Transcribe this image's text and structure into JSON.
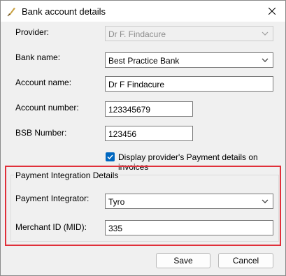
{
  "window": {
    "title": "Bank account details"
  },
  "form": {
    "provider": {
      "label": "Provider:",
      "value": "Dr F. Findacure"
    },
    "bank_name": {
      "label": "Bank name:",
      "value": "Best Practice Bank"
    },
    "account_name": {
      "label": "Account name:",
      "value": "Dr F Findacure"
    },
    "account_number": {
      "label": "Account number:",
      "value": "123345679"
    },
    "bsb_number": {
      "label": "BSB Number:",
      "value": "123456"
    },
    "display_checkbox": {
      "label": "Display provider's Payment details on invoices",
      "checked": true
    }
  },
  "payment_group": {
    "title": "Payment Integration Details",
    "integrator": {
      "label": "Payment Integrator:",
      "value": "Tyro"
    },
    "merchant_id": {
      "label": "Merchant ID (MID):",
      "value": "335"
    }
  },
  "buttons": {
    "save": "Save",
    "cancel": "Cancel"
  },
  "colors": {
    "accent": "#0067c0",
    "highlight": "#e0303a"
  }
}
